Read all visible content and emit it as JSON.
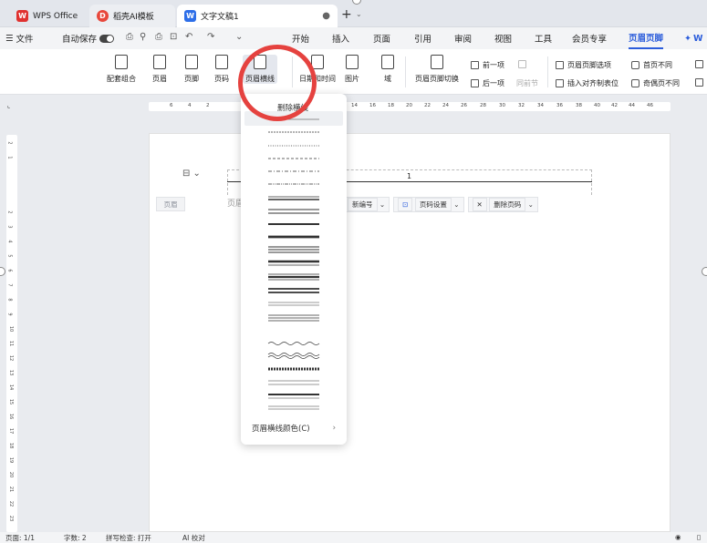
{
  "titlebar": {
    "tabs": [
      {
        "label": "WPS Office",
        "logo": "W"
      },
      {
        "label": "稻壳AI模板",
        "logo": "D"
      },
      {
        "label": "文字文稿1",
        "logo": "W"
      }
    ]
  },
  "menubar": {
    "file": "文件",
    "autosave": "自动保存",
    "tabs": [
      "开始",
      "插入",
      "页面",
      "引用",
      "审阅",
      "视图",
      "工具",
      "会员专享",
      "页眉页脚"
    ],
    "active_tab": "页眉页脚",
    "overflow_label": "W"
  },
  "ribbon": {
    "buttons": [
      {
        "label": "配套组合"
      },
      {
        "label": "页眉"
      },
      {
        "label": "页脚"
      },
      {
        "label": "页码"
      },
      {
        "label": "页眉横线"
      },
      {
        "label": "日期和时间"
      },
      {
        "label": "图片"
      },
      {
        "label": "域"
      },
      {
        "label": "页眉页脚切换"
      }
    ],
    "small": {
      "prev": "前一项",
      "next": "后一项",
      "same_as_prev": "同前节",
      "options": "页眉页脚选项",
      "insert_align_tab": "插入对齐制表位",
      "first_page_diff": "首页不同",
      "odd_even_diff": "奇偶页不同"
    }
  },
  "ruler": {
    "numbers": [
      "6",
      "4",
      "2",
      "14",
      "16",
      "18",
      "20",
      "22",
      "24",
      "26",
      "28",
      "30",
      "32",
      "34",
      "36",
      "38",
      "40",
      "42",
      "44",
      "46"
    ],
    "vertical": [
      "2",
      "1",
      "1",
      "2",
      "3",
      "4",
      "5",
      "6",
      "7",
      "8",
      "9",
      "10",
      "11",
      "12",
      "13",
      "14",
      "15",
      "16",
      "17",
      "18",
      "19",
      "20",
      "21",
      "22",
      "23",
      "24",
      "25",
      "26"
    ]
  },
  "document": {
    "page_number": "1",
    "header_tag": "页眉",
    "header_placeholder": "页眉",
    "page_tools": [
      "新编号",
      "页码设置",
      "删除页码"
    ]
  },
  "dropdown": {
    "delete_label": "删除横线",
    "color_label": "页眉横线颜色(C)",
    "line_styles": [
      "none",
      "thin-solid",
      "dotted",
      "dashed",
      "dash-dot",
      "dash-dot-dot",
      "thin-thick",
      "double-thin",
      "medium-solid",
      "thick-solid",
      "triple",
      "thick-thin",
      "thin-thick-thin",
      "heavy-double",
      "thin-double",
      "wavy",
      "double-wavy",
      "striped",
      "thick-medium",
      "double-thick"
    ],
    "selected": "none"
  },
  "statusbar": {
    "page": "页面: 1/1",
    "words": "字数: 2",
    "spell": "拼写检查: 打开",
    "ai": "AI 校对"
  },
  "colors": {
    "accent": "#2c5ddb",
    "highlight_circle": "#e5423f",
    "wps_red": "#e0312f"
  }
}
